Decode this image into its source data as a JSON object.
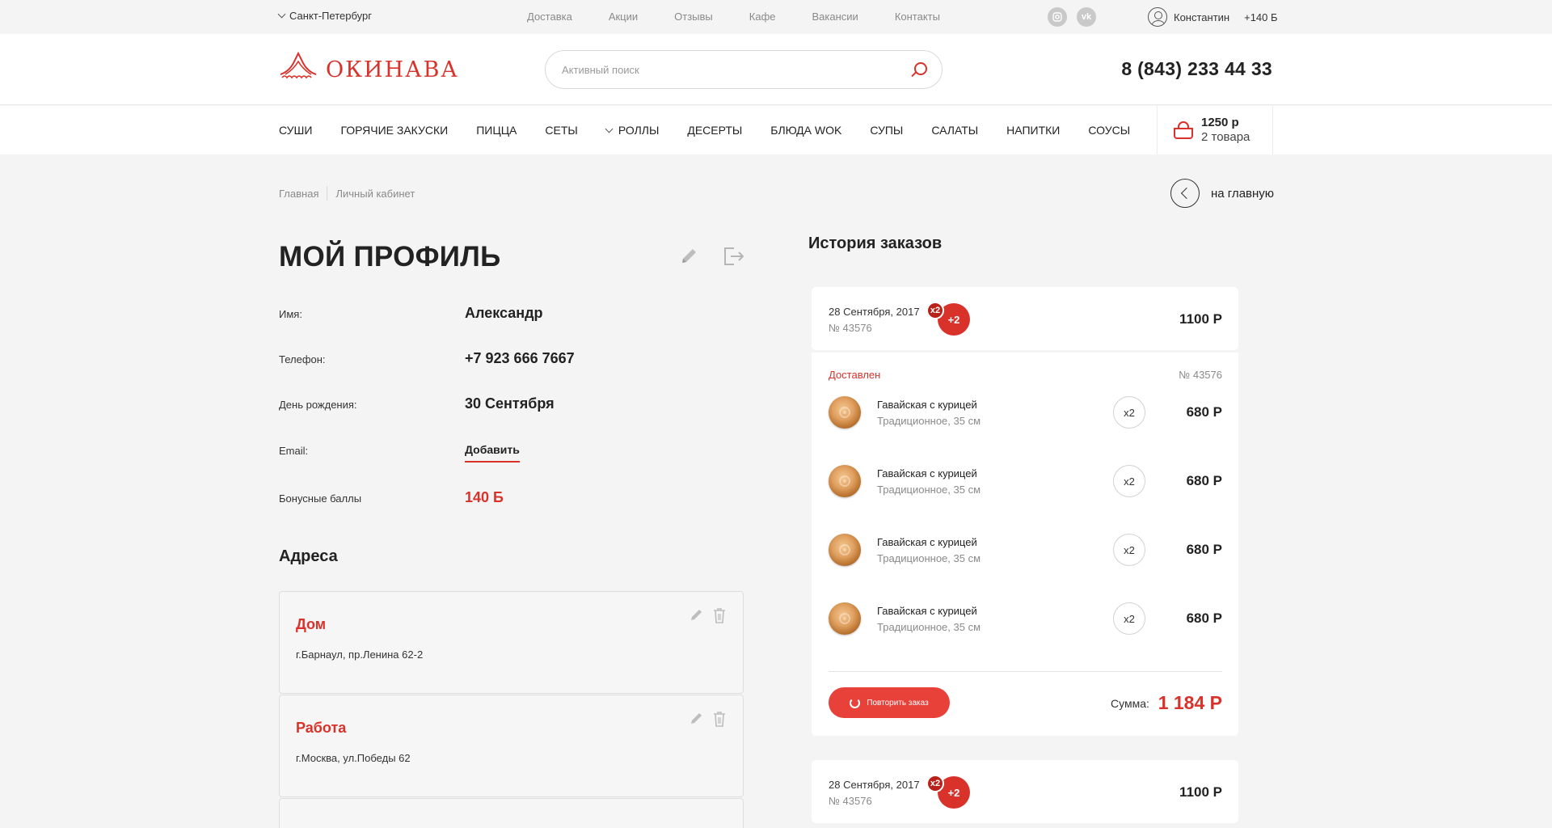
{
  "topbar": {
    "city": "Санкт-Петербург",
    "nav": [
      "Доставка",
      "Акции",
      "Отзывы",
      "Кафе",
      "Вакансии",
      "Контакты"
    ],
    "user_name": "Константин",
    "user_points": "+140 Б"
  },
  "header": {
    "logo_text": "ОКИНАВА",
    "search_placeholder": "Активный поиск",
    "phone": "8 (843) 233 44 33"
  },
  "categories": [
    "СУШИ",
    "ГОРЯЧИЕ ЗАКУСКИ",
    "ПИЦЦА",
    "СЕТЫ",
    "РОЛЛЫ",
    "ДЕСЕРТЫ",
    "БЛЮДА WOK",
    "СУПЫ",
    "САЛАТЫ",
    "НАПИТКИ",
    "СОУСЫ"
  ],
  "cart": {
    "total": "1250 р",
    "count": "2 товара"
  },
  "breadcrumbs": [
    "Главная",
    "Личный кабинет"
  ],
  "home_link": "на главную",
  "profile": {
    "title": "МОЙ ПРОФИЛЬ",
    "fields": [
      {
        "label": "Имя:",
        "value": "Александр"
      },
      {
        "label": "Телефон:",
        "value": "+7 923 666 7667"
      },
      {
        "label": "День рождения:",
        "value": "30 Сентября"
      },
      {
        "label": "Email:",
        "value": "Добавить"
      },
      {
        "label": "Бонусные баллы",
        "value": "140 Б"
      }
    ]
  },
  "addresses": {
    "title": "Адреса",
    "items": [
      {
        "name": "Дом",
        "address": "г.Барнаул, пр.Ленина 62-2"
      },
      {
        "name": "Работа",
        "address": "г.Москва, ул.Победы 62"
      }
    ]
  },
  "history": {
    "title": "История заказов",
    "orders": [
      {
        "date": "28 Сентября, 2017",
        "number": "№ 43576",
        "mini_badge": "x2",
        "extra_badge": "+2",
        "sum": "1100 Р",
        "status": "Доставлен",
        "items": [
          {
            "name": "Гавайская с курицей",
            "desc": "Традиционное, 35 см",
            "qty": "x2",
            "price": "680 Р"
          },
          {
            "name": "Гавайская с курицей",
            "desc": "Традиционное, 35 см",
            "qty": "x2",
            "price": "680 Р"
          },
          {
            "name": "Гавайская с курицей",
            "desc": "Традиционное, 35 см",
            "qty": "x2",
            "price": "680 Р"
          },
          {
            "name": "Гавайская с курицей",
            "desc": "Традиционное, 35 см",
            "qty": "x2",
            "price": "680 Р"
          }
        ],
        "repeat_label": "Повторить заказ",
        "sum_label": "Сумма:",
        "sum_total": "1 184 Р"
      },
      {
        "date": "28 Сентября, 2017",
        "number": "№ 43576",
        "mini_badge": "x2",
        "extra_badge": "+2",
        "sum": "1100 Р"
      }
    ]
  },
  "colors": {
    "accent": "#d9322b",
    "text": "#222222",
    "muted": "#8a8a8a",
    "background": "#f4f4f4"
  },
  "icons": {
    "instagram": "instagram-icon",
    "vk": "vk-icon"
  }
}
